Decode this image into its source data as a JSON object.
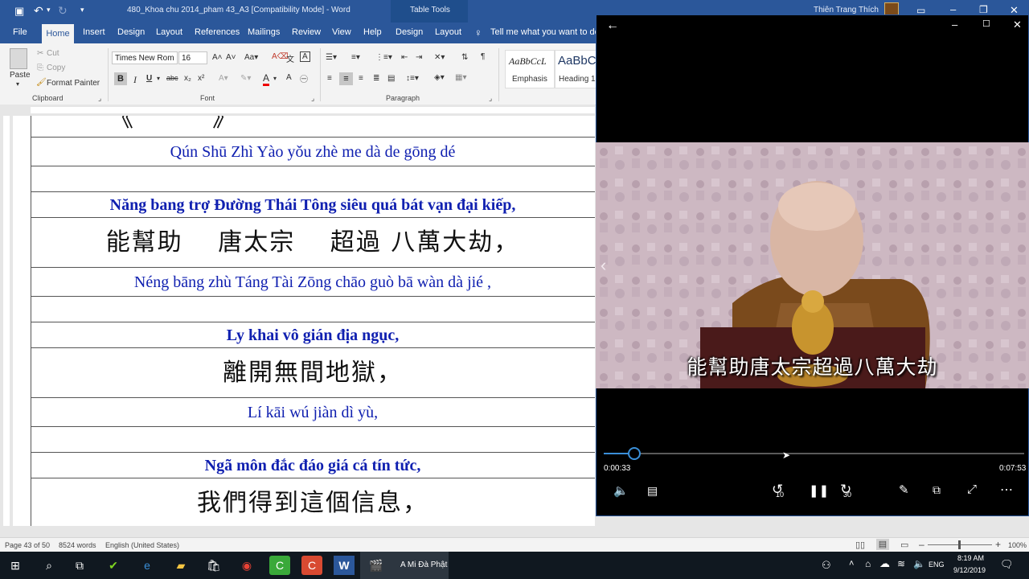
{
  "word": {
    "title": "480_Khoa chu 2014_pham 43_A3 [Compatibility Mode]  -  Word",
    "contextual_label": "Table Tools",
    "user": "Thiên Trang Thích",
    "tabs": [
      "File",
      "Home",
      "Insert",
      "Design",
      "Layout",
      "References",
      "Mailings",
      "Review",
      "View",
      "Help",
      "Design",
      "Layout"
    ],
    "tell_me": "Tell me what you want to do",
    "clipboard": {
      "paste": "Paste",
      "cut": "Cut",
      "copy": "Copy",
      "format_painter": "Format Painter",
      "label": "Clipboard"
    },
    "font": {
      "name": "Times New Rom",
      "size": "16",
      "label": "Font",
      "bold": "B",
      "italic": "I",
      "underline": "U",
      "strike": "abc"
    },
    "paragraph_label": "Paragraph",
    "styles": [
      {
        "preview": "AaBbCcL",
        "name": "Emphasis"
      },
      {
        "preview": "AaBbC",
        "name": "Heading 1"
      }
    ],
    "document": {
      "rows": [
        {
          "type": "pin",
          "text": "Qún Shū Zhì Yào   yǒu zhè me dà de gōng dé"
        },
        {
          "type": "blank",
          "text": ""
        },
        {
          "type": "vn",
          "text": "Năng bang trợ Đường Thái Tông siêu quá bát vạn đại kiếp,"
        },
        {
          "type": "zh",
          "text": "能幫助　 唐太宗　 超過 八萬大劫，"
        },
        {
          "type": "pin",
          "text": "Néng bāng zhù  Táng Tài Zōng  chāo guò  bā wàn dà jié ,"
        },
        {
          "type": "blank",
          "text": ""
        },
        {
          "type": "vn",
          "text": "Ly khai vô gián địa ngục,"
        },
        {
          "type": "zh",
          "text": "離開無間地獄，"
        },
        {
          "type": "pin",
          "text": "Lí kāi wú jiàn dì yù,"
        },
        {
          "type": "blank",
          "text": ""
        },
        {
          "type": "vn",
          "text": "Ngã môn đắc đáo giá cá tín tức,"
        },
        {
          "type": "zh",
          "text": "我們得到這個信息，"
        }
      ]
    },
    "status": {
      "page": "Page 43 of 50",
      "words": "8524 words",
      "language": "English (United States)",
      "zoom": "100%"
    }
  },
  "player": {
    "subtitle": "能幫助唐太宗超過八萬大劫",
    "elapsed": "0:00:33",
    "duration": "0:07:53",
    "progress": 0.07,
    "skip_back": "10",
    "skip_forward": "30"
  },
  "taskbar": {
    "active_app": "A Mi Đà Phật",
    "language": "ENG",
    "time": "8:19 AM",
    "date": "9/12/2019"
  }
}
